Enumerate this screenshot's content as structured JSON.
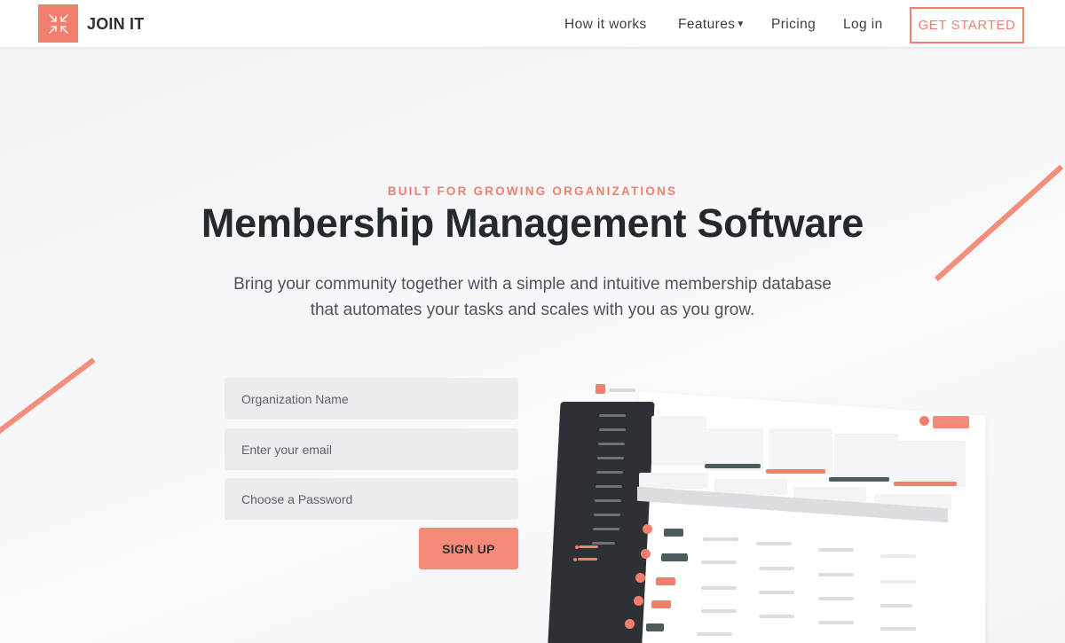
{
  "header": {
    "brand": "JOIN IT",
    "nav": [
      {
        "label": "How it works"
      },
      {
        "label": "Features"
      },
      {
        "label": "Pricing"
      },
      {
        "label": "Log in"
      }
    ],
    "cta_label": "GET STARTED"
  },
  "hero": {
    "eyebrow": "BUILT FOR GROWING ORGANIZATIONS",
    "title": "Membership Management Software",
    "subtitle_line1": "Bring your community together with a simple and intuitive membership database",
    "subtitle_line2": "that automates your tasks and scales with you as you grow."
  },
  "form": {
    "org_placeholder": "Organization Name",
    "email_placeholder": "Enter your email",
    "password_placeholder": "Choose a Password",
    "signup_label": "SIGN UP"
  },
  "icons": {
    "logo": "join-it-arrows-logo-icon",
    "features_caret": "caret-down-icon"
  },
  "colors": {
    "accent": "#f27f6e",
    "dark": "#24292e",
    "sidebar": "#2d3136",
    "teal_bar": "#4d5c5d"
  }
}
